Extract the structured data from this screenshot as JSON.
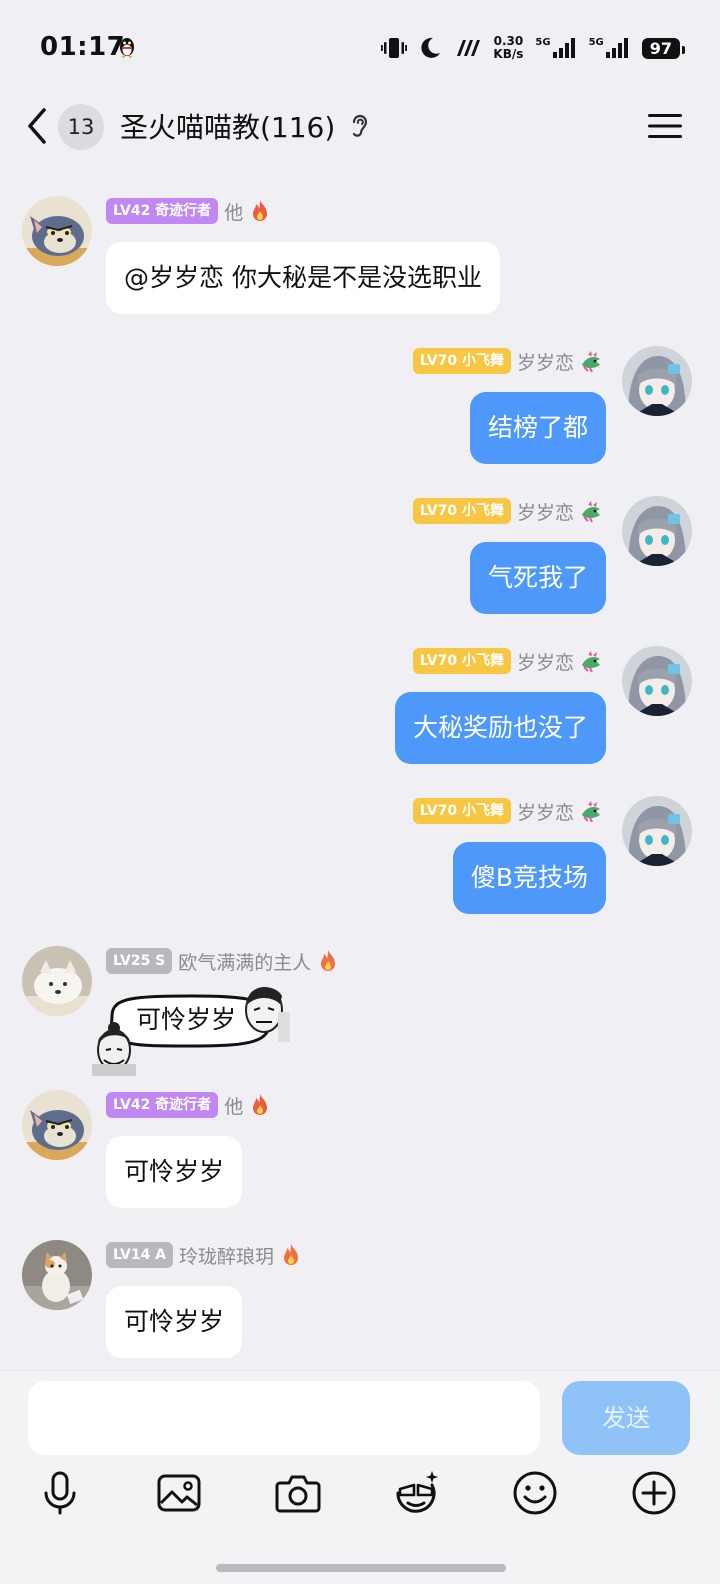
{
  "status": {
    "time": "01:17",
    "net_speed_value": "0.30",
    "net_speed_unit": "KB/s",
    "sim1": "5G",
    "sim2": "5G",
    "battery": "97"
  },
  "header": {
    "unread": "13",
    "title": "圣火喵喵教(116)"
  },
  "colors": {
    "badge_purple": "#c088f0",
    "badge_yellow": "#f7c744",
    "badge_gray": "#b8b8bd",
    "bubble_out": "#4d98f8",
    "send_disabled": "#8fc2f6"
  },
  "messages": [
    {
      "side": "in",
      "badge": "LV42 奇迹行者",
      "nick": "他",
      "text": "@岁岁恋 你大秘是不是没选职业"
    },
    {
      "side": "out",
      "badge": "LV70 小飞舞",
      "nick": "岁岁恋",
      "text": "结榜了都"
    },
    {
      "side": "out",
      "badge": "LV70 小飞舞",
      "nick": "岁岁恋",
      "text": "气死我了"
    },
    {
      "side": "out",
      "badge": "LV70 小飞舞",
      "nick": "岁岁恋",
      "text": "大秘奖励也没了"
    },
    {
      "side": "out",
      "badge": "LV70 小飞舞",
      "nick": "岁岁恋",
      "text": "傻B竞技场"
    },
    {
      "side": "in",
      "badge": "LV25 S",
      "nick": "欧气满满的主人",
      "text": "可怜岁岁"
    },
    {
      "side": "in",
      "badge": "LV42 奇迹行者",
      "nick": "他",
      "text": "可怜岁岁"
    },
    {
      "side": "in",
      "badge": "LV14 A",
      "nick": "玲珑醉琅玥",
      "text": "可怜岁岁"
    }
  ],
  "input": {
    "value": "",
    "send_label": "发送"
  },
  "toolbar": [
    "microphone-icon",
    "image-icon",
    "camera-icon",
    "sticker-icon",
    "emoji-icon",
    "plus-icon"
  ]
}
